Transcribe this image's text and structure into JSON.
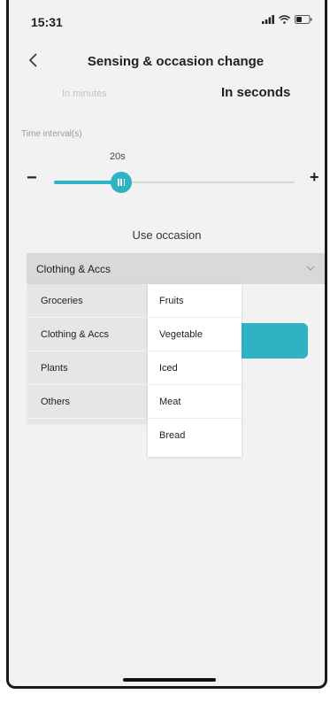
{
  "status": {
    "time": "15:31",
    "signal_icon": "signal-icon",
    "wifi_icon": "wifi-icon",
    "battery_icon": "battery-icon"
  },
  "nav": {
    "title": "Sensing & occasion change",
    "back_icon": "back-chevron-icon"
  },
  "mode": {
    "minutes_label": "In minutes",
    "seconds_label": "In seconds",
    "selected": "seconds"
  },
  "interval": {
    "label": "Time interval(s)",
    "value_text": "20s",
    "level": 0.28,
    "minus": "−",
    "plus": "+"
  },
  "occasion": {
    "label": "Use occasion",
    "selected_value": "Clothing & Accs",
    "chevron_icon": "chevron-down-icon"
  },
  "dropdown": {
    "categories": [
      "Groceries",
      "Clothing & Accs",
      "Plants",
      "Others"
    ],
    "subcategories": [
      "Fruits",
      "Vegetable",
      "Iced",
      "Meat",
      "Bread"
    ]
  },
  "colors": {
    "accent": "#2fb2c4",
    "background": "#f2f2f2",
    "select_bg": "#d9d9d9"
  }
}
